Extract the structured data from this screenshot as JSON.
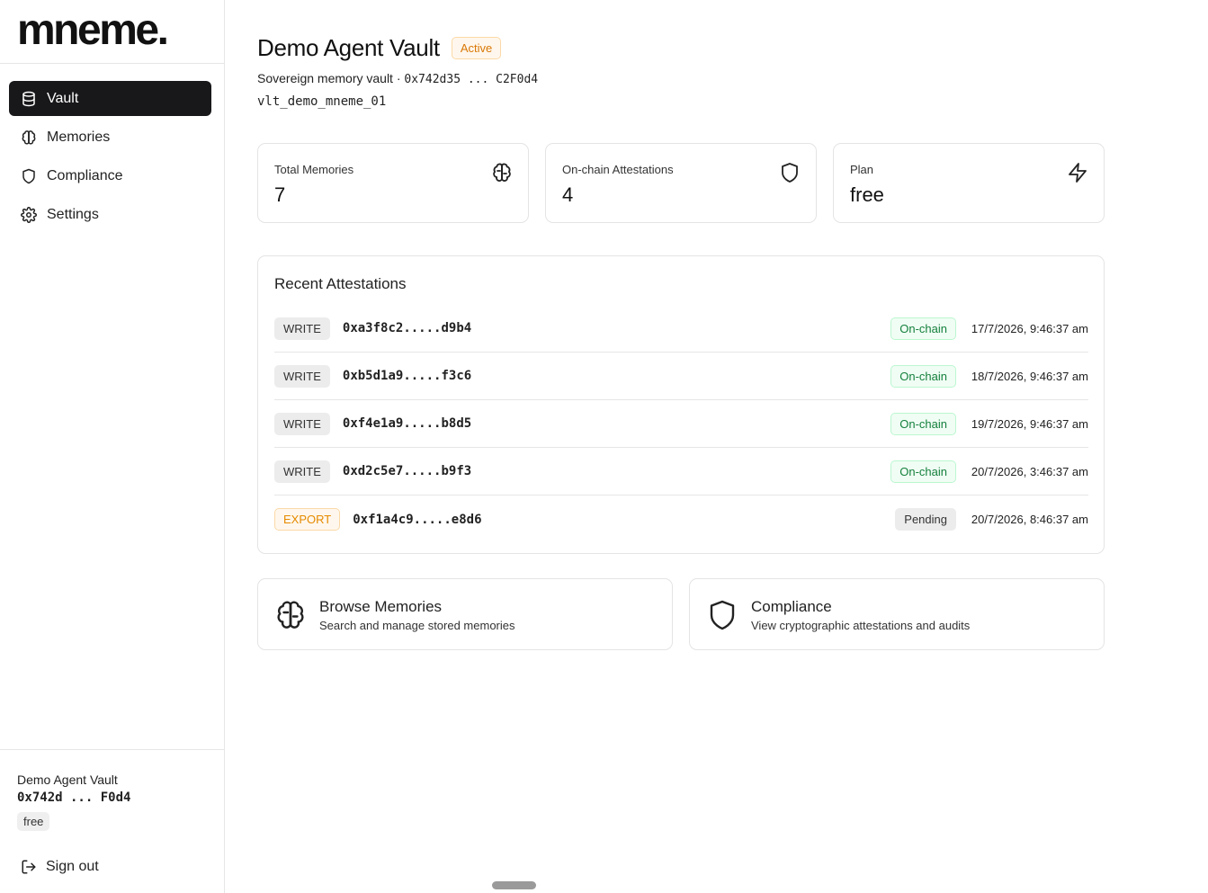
{
  "brand": {
    "logo_text": "mneme."
  },
  "sidebar": {
    "items": [
      {
        "label": "Vault",
        "icon": "database-icon",
        "active": true
      },
      {
        "label": "Memories",
        "icon": "brain-icon",
        "active": false
      },
      {
        "label": "Compliance",
        "icon": "shield-icon",
        "active": false
      },
      {
        "label": "Settings",
        "icon": "gear-icon",
        "active": false
      }
    ],
    "footer": {
      "vault_name": "Demo Agent Vault",
      "address": "0x742d ... F0d4",
      "plan": "free",
      "signout_label": "Sign out"
    }
  },
  "header": {
    "title": "Demo Agent Vault",
    "status": "Active",
    "subtitle_text": "Sovereign memory vault · ",
    "subtitle_address": "0x742d35 ... C2F0d4",
    "vault_id": "vlt_demo_mneme_01"
  },
  "stats": [
    {
      "label": "Total Memories",
      "value": "7",
      "icon": "brain-icon"
    },
    {
      "label": "On-chain Attestations",
      "value": "4",
      "icon": "shield-icon"
    },
    {
      "label": "Plan",
      "value": "free",
      "icon": "lightning-icon"
    }
  ],
  "recent": {
    "title": "Recent Attestations",
    "rows": [
      {
        "op": "WRITE",
        "hash": "0xa3f8c2.....d9b4",
        "status": "On-chain",
        "timestamp": "17/7/2026, 9:46:37 am"
      },
      {
        "op": "WRITE",
        "hash": "0xb5d1a9.....f3c6",
        "status": "On-chain",
        "timestamp": "18/7/2026, 9:46:37 am"
      },
      {
        "op": "WRITE",
        "hash": "0xf4e1a9.....b8d5",
        "status": "On-chain",
        "timestamp": "19/7/2026, 9:46:37 am"
      },
      {
        "op": "WRITE",
        "hash": "0xd2c5e7.....b9f3",
        "status": "On-chain",
        "timestamp": "20/7/2026, 3:46:37 am"
      },
      {
        "op": "EXPORT",
        "hash": "0xf1a4c9.....e8d6",
        "status": "Pending",
        "timestamp": "20/7/2026, 8:46:37 am"
      }
    ]
  },
  "quick_links": [
    {
      "title": "Browse Memories",
      "description": "Search and manage stored memories",
      "icon": "brain-icon"
    },
    {
      "title": "Compliance",
      "description": "View cryptographic attestations and audits",
      "icon": "shield-icon"
    }
  ],
  "colors": {
    "active_nav_bg": "#18181b",
    "active_badge": "#d97706",
    "onchain_green": "#15803d",
    "export_orange": "#e68a00"
  }
}
